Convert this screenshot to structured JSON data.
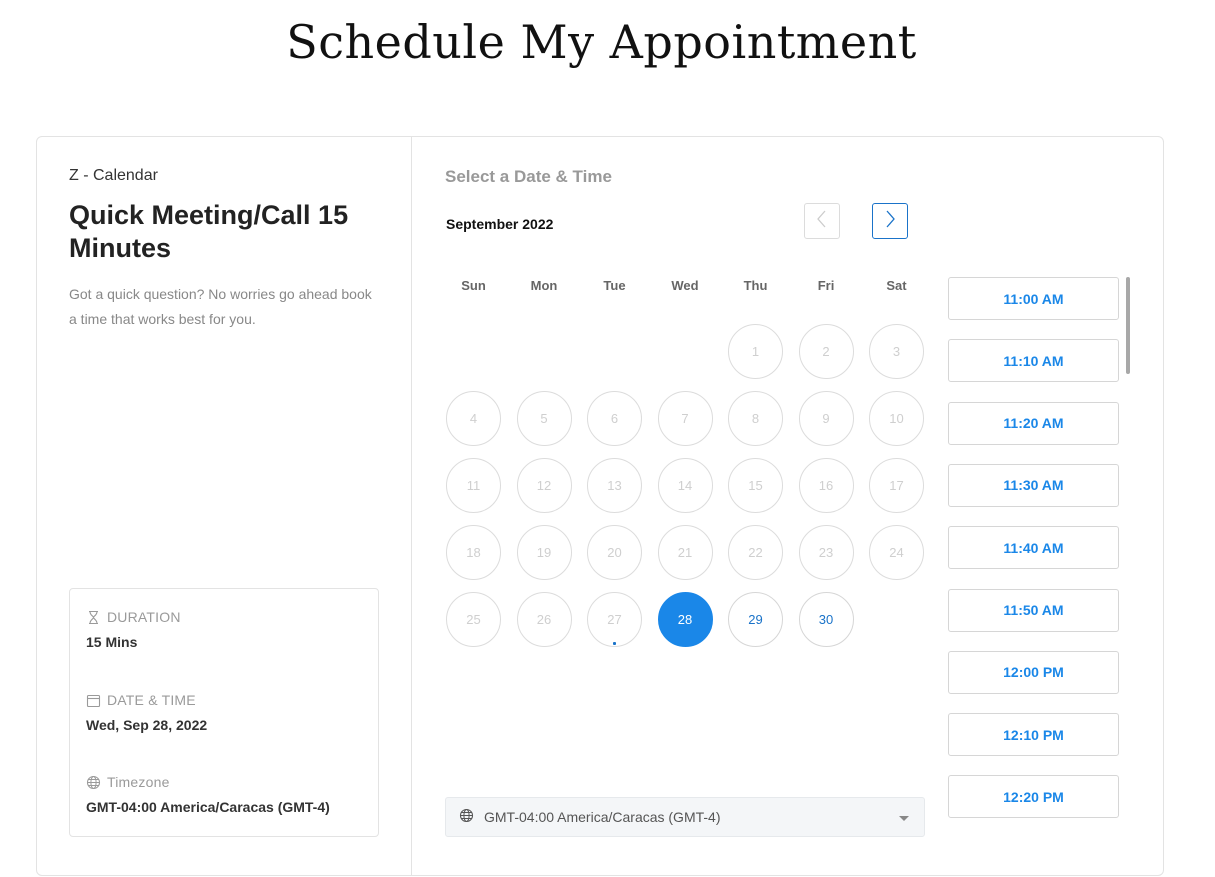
{
  "page": {
    "title": "Schedule My Appointment"
  },
  "event": {
    "calendar_name": "Z - Calendar",
    "title": "Quick Meeting/Call 15 Minutes",
    "description": "Got a quick question? No worries go ahead book a time that works best for you."
  },
  "details": {
    "duration_label": "DURATION",
    "duration_value": "15 Mins",
    "datetime_label": "DATE & TIME",
    "datetime_value": "Wed, Sep 28, 2022",
    "timezone_label": "Timezone",
    "timezone_value": "GMT-04:00 America/Caracas (GMT-4)"
  },
  "scheduler": {
    "heading": "Select a Date & Time",
    "month_label": "September 2022",
    "weekdays": [
      "Sun",
      "Mon",
      "Tue",
      "Wed",
      "Thu",
      "Fri",
      "Sat"
    ],
    "first_weekday_index": 4,
    "days_in_month": 30,
    "today": 27,
    "selected_day": 28,
    "available_days": [
      28,
      29,
      30
    ]
  },
  "time_slots": [
    "11:00 AM",
    "11:10 AM",
    "11:20 AM",
    "11:30 AM",
    "11:40 AM",
    "11:50 AM",
    "12:00 PM",
    "12:10 PM",
    "12:20 PM"
  ],
  "timezone_select": {
    "value": "GMT-04:00 America/Caracas (GMT-4)"
  },
  "colors": {
    "accent": "#1a87e8",
    "link_blue": "#1a73c9",
    "disabled_text": "#cfcfcf",
    "muted_text": "#999999"
  },
  "icons": {
    "prev": "chevron-left-icon",
    "next": "chevron-right-icon",
    "duration": "hourglass-icon",
    "datetime": "calendar-icon",
    "timezone": "globe-icon",
    "dropdown": "caret-down-icon"
  }
}
